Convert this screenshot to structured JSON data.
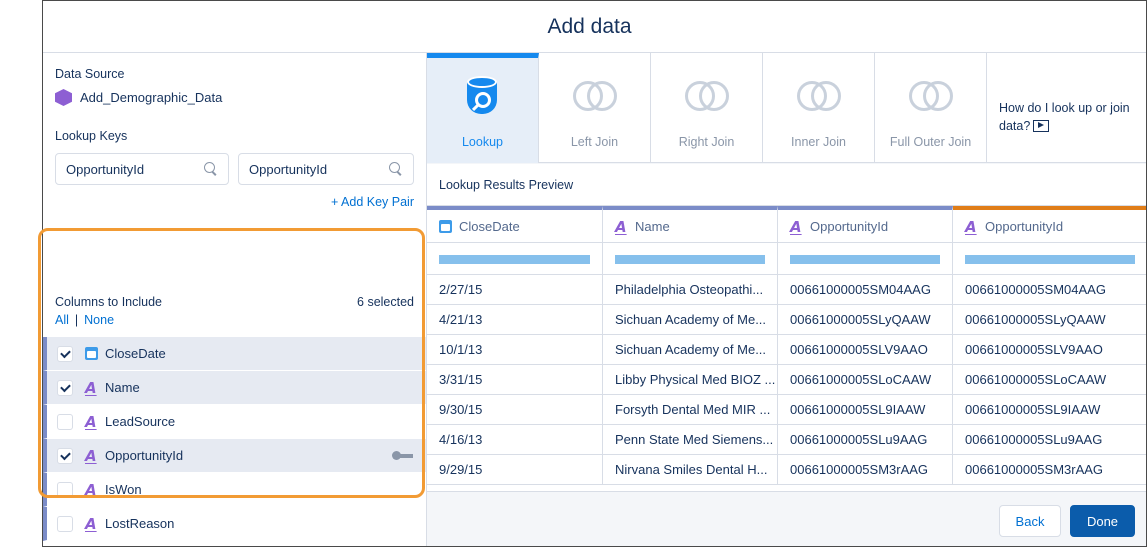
{
  "dialog": {
    "title": "Add data"
  },
  "left": {
    "data_source_label": "Data Source",
    "data_source_name": "Add_Demographic_Data",
    "lookup_keys_label": "Lookup Keys",
    "key_left": "OpportunityId",
    "key_right": "OpportunityId",
    "add_key_pair": "+ Add Key Pair",
    "columns_label": "Columns to Include",
    "selected_count": "6 selected",
    "all_link": "All",
    "separator": "|",
    "none_link": "None",
    "columns": [
      {
        "name": "CloseDate",
        "type": "date",
        "checked": true
      },
      {
        "name": "Name",
        "type": "text",
        "checked": true
      },
      {
        "name": "LeadSource",
        "type": "text",
        "checked": false
      },
      {
        "name": "OpportunityId",
        "type": "text",
        "checked": true,
        "is_key": true
      },
      {
        "name": "IsWon",
        "type": "text",
        "checked": false
      },
      {
        "name": "LostReason",
        "type": "text",
        "checked": false
      }
    ],
    "type_glyph": "A"
  },
  "joins": {
    "tiles": [
      {
        "label": "Lookup",
        "active": true
      },
      {
        "label": "Left Join",
        "active": false
      },
      {
        "label": "Right Join",
        "active": false
      },
      {
        "label": "Inner Join",
        "active": false
      },
      {
        "label": "Full Outer Join",
        "active": false
      }
    ],
    "help_text": "How do I look up or join data?"
  },
  "preview": {
    "label": "Lookup Results Preview",
    "headers": [
      "CloseDate",
      "Name",
      "OpportunityId",
      "OpportunityId"
    ],
    "rows": [
      [
        "2/27/15",
        "Philadelphia Osteopathi...",
        "00661000005SM04AAG",
        "00661000005SM04AAG"
      ],
      [
        "4/21/13",
        "Sichuan Academy of Me...",
        "00661000005SLyQAAW",
        "00661000005SLyQAAW"
      ],
      [
        "10/1/13",
        "Sichuan Academy of Me...",
        "00661000005SLV9AAO",
        "00661000005SLV9AAO"
      ],
      [
        "3/31/15",
        "Libby Physical Med BIOZ ...",
        "00661000005SLoCAAW",
        "00661000005SLoCAAW"
      ],
      [
        "9/30/15",
        "Forsyth Dental Med MIR ...",
        "00661000005SL9IAAW",
        "00661000005SL9IAAW"
      ],
      [
        "4/16/13",
        "Penn State Med Siemens...",
        "00661000005SLu9AAG",
        "00661000005SLu9AAG"
      ],
      [
        "9/29/15",
        "Nirvana Smiles Dental H...",
        "00661000005SM3rAAG",
        "00661000005SM3rAAG"
      ]
    ]
  },
  "footer": {
    "back_label": "Back",
    "done_label": "Done"
  },
  "colors": {
    "accent": "#1589ee",
    "highlight": "#f29b34",
    "type_icon": "#8d5fd3",
    "done_button": "#0b5cab"
  }
}
